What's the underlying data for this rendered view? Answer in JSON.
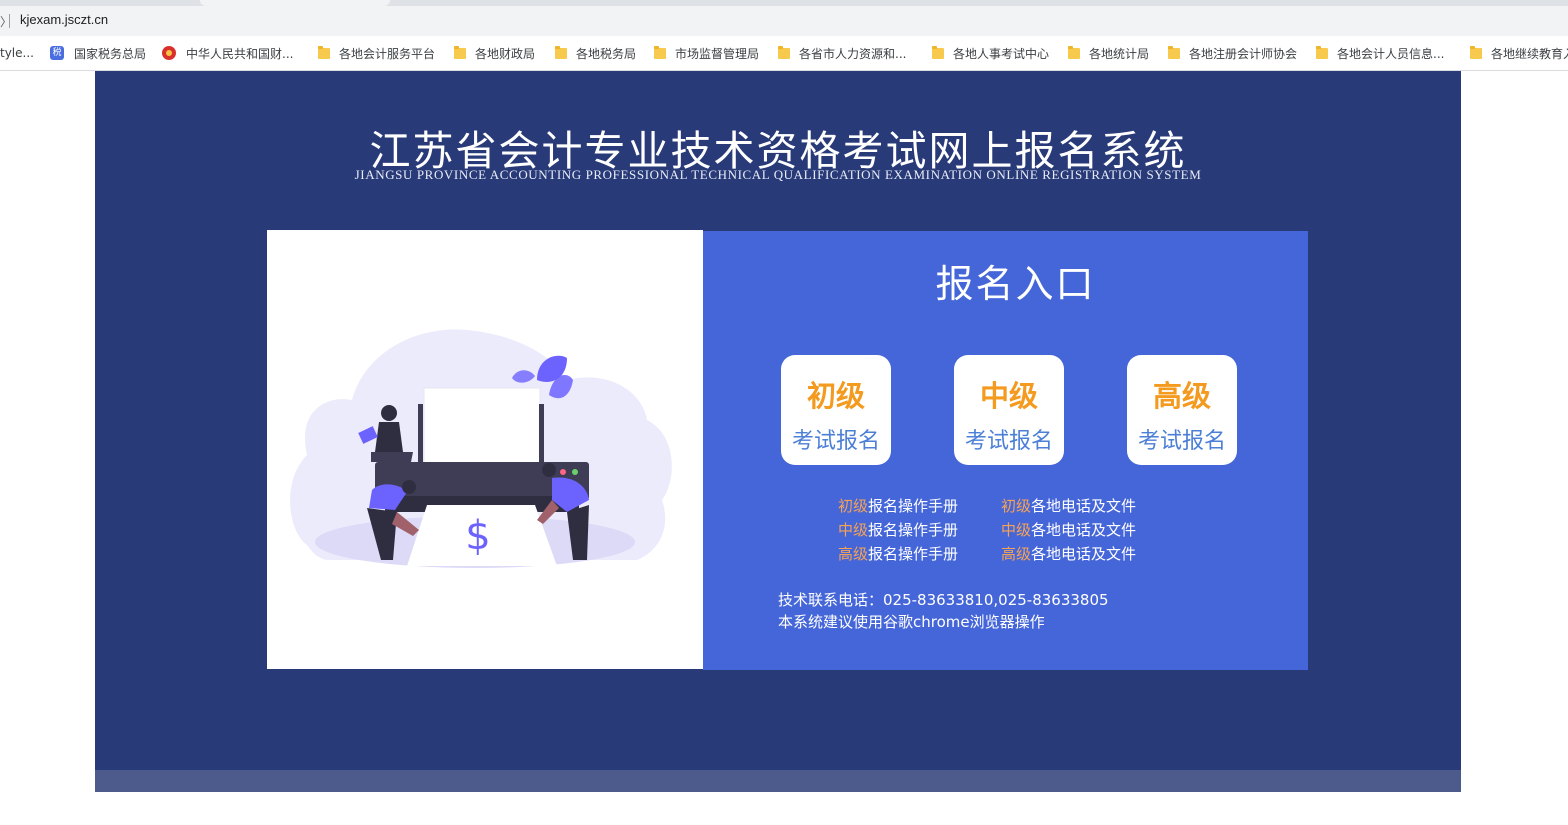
{
  "browser": {
    "address_left": "〉",
    "url": "kjexam.jsczt.cn",
    "bookmarks": [
      {
        "label": "tyle...",
        "icon": "none"
      },
      {
        "label": "国家税务总局",
        "icon": "tax-bureau-icon"
      },
      {
        "label": "中华人民共和国财...",
        "icon": "national-emblem-icon"
      },
      {
        "label": "各地会计服务平台",
        "icon": "folder-icon"
      },
      {
        "label": "各地财政局",
        "icon": "folder-icon"
      },
      {
        "label": "各地税务局",
        "icon": "folder-icon"
      },
      {
        "label": "市场监督管理局",
        "icon": "folder-icon"
      },
      {
        "label": "各省市人力资源和...",
        "icon": "folder-icon"
      },
      {
        "label": "各地人事考试中心",
        "icon": "folder-icon"
      },
      {
        "label": "各地统计局",
        "icon": "folder-icon"
      },
      {
        "label": "各地注册会计师协会",
        "icon": "folder-icon"
      },
      {
        "label": "各地会计人员信息...",
        "icon": "folder-icon"
      },
      {
        "label": "各地继续教育入",
        "icon": "folder-icon"
      }
    ],
    "tax_icon_text": "税"
  },
  "header": {
    "title": "江苏省会计专业技术资格考试网上报名系统",
    "subtitle": "JIANGSU PROVINCE ACCOUNTING PROFESSIONAL TECHNICAL QUALIFICATION EXAMINATION ONLINE REGISTRATION SYSTEM"
  },
  "illustration": {
    "icon": "printer-money-illustration",
    "symbol": "$"
  },
  "entry": {
    "title": "报名入口",
    "levels": [
      {
        "level": "初级",
        "label": "考试报名"
      },
      {
        "level": "中级",
        "label": "考试报名"
      },
      {
        "level": "高级",
        "label": "考试报名"
      }
    ],
    "manual_links": [
      {
        "level": "初级",
        "text": "报名操作手册"
      },
      {
        "level": "中级",
        "text": "报名操作手册"
      },
      {
        "level": "高级",
        "text": "报名操作手册"
      }
    ],
    "file_links": [
      {
        "level": "初级",
        "text": "各地电话及文件"
      },
      {
        "level": "中级",
        "text": "各地电话及文件"
      },
      {
        "level": "高级",
        "text": "各地电话及文件"
      }
    ],
    "contact_phone": "技术联系电话：025-83633810,025-83633805",
    "browser_tip": "本系统建议使用谷歌chrome浏览器操作"
  },
  "colors": {
    "page_bg": "#293a78",
    "panel_blue": "#4566d8",
    "level_orange": "#f39a1f",
    "link_highlight": "#f5a256",
    "button_label_blue": "#4c7fd6"
  }
}
